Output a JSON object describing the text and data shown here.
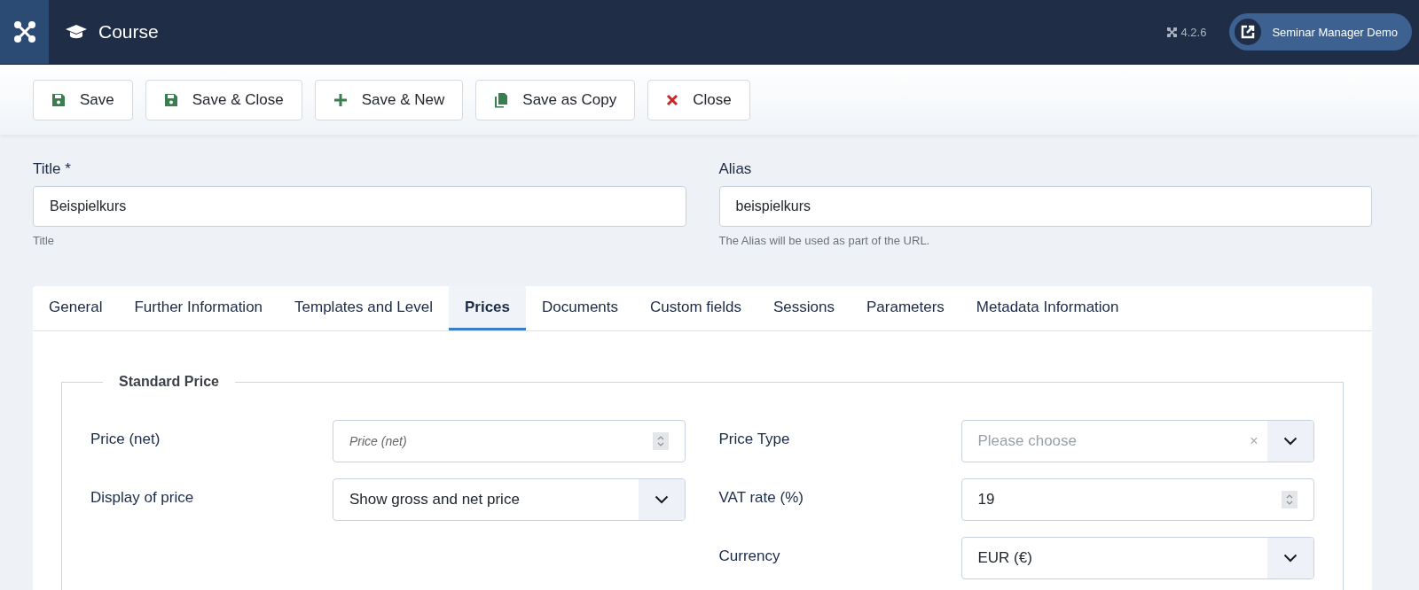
{
  "header": {
    "title": "Course",
    "version": "4.2.6",
    "site_button": "Seminar Manager Demo"
  },
  "toolbar": [
    {
      "label": "Save",
      "kind": "save"
    },
    {
      "label": "Save & Close",
      "kind": "save"
    },
    {
      "label": "Save & New",
      "kind": "new"
    },
    {
      "label": "Save as Copy",
      "kind": "copy"
    },
    {
      "label": "Close",
      "kind": "close"
    }
  ],
  "title_field": {
    "label": "Title *",
    "value": "Beispielkurs",
    "hint": "Title"
  },
  "alias_field": {
    "label": "Alias",
    "value": "beispielkurs",
    "hint": "The Alias will be used as part of the URL."
  },
  "tabs": [
    {
      "label": "General",
      "selected": false
    },
    {
      "label": "Further Information",
      "selected": false
    },
    {
      "label": "Templates and Level",
      "selected": false
    },
    {
      "label": "Prices",
      "selected": true
    },
    {
      "label": "Documents",
      "selected": false
    },
    {
      "label": "Custom fields",
      "selected": false
    },
    {
      "label": "Sessions",
      "selected": false
    },
    {
      "label": "Parameters",
      "selected": false
    },
    {
      "label": "Metadata Information",
      "selected": false
    }
  ],
  "fieldset": {
    "legend": "Standard Price",
    "left": [
      {
        "label": "Price (net)",
        "kind": "number",
        "placeholder": "Price (net)"
      },
      {
        "label": "Display of price",
        "kind": "select",
        "value": "Show gross and net price"
      }
    ],
    "right": [
      {
        "label": "Price Type",
        "kind": "select",
        "placeholder": "Please choose",
        "clear_symbol": "×"
      },
      {
        "label": "VAT rate (%)",
        "kind": "number",
        "value": "19"
      },
      {
        "label": "Currency",
        "kind": "select",
        "value": "EUR (€)"
      }
    ]
  }
}
